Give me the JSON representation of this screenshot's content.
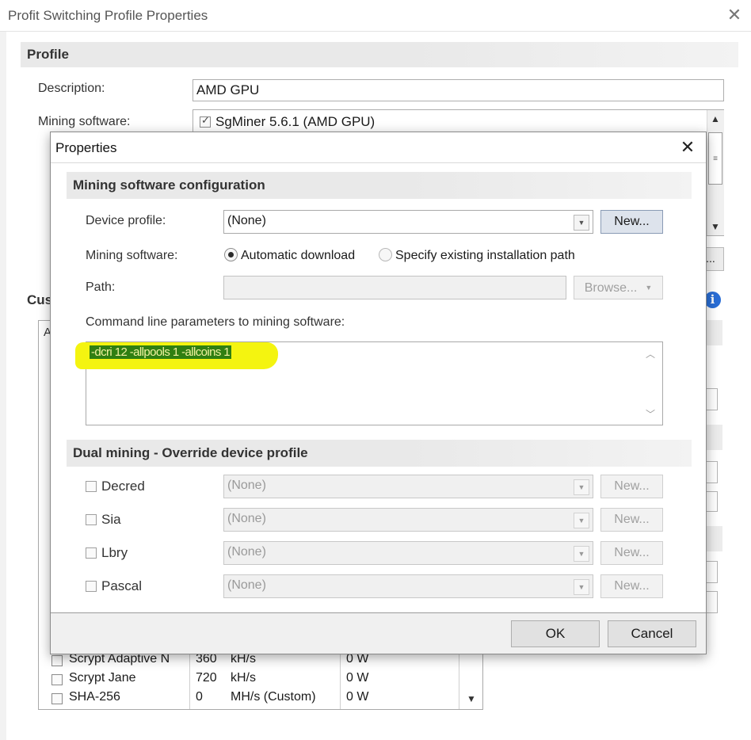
{
  "back_window": {
    "title": "Profit Switching Profile Properties",
    "close_glyph": "✕",
    "profile_section": "Profile",
    "description_label": "Description:",
    "description_value": "AMD GPU",
    "mining_software_label": "Mining software:",
    "mining_software_item": "SgMiner 5.6.1 (AMD GPU)",
    "dots_button": "...",
    "custom_section_partial": "Cus",
    "table_header_partial": "A",
    "algorithms": [
      {
        "name": "Scrypt Adaptive N",
        "value": "360",
        "unit": "kH/s",
        "power": "0 W"
      },
      {
        "name": "Scrypt Jane",
        "value": "720",
        "unit": "kH/s",
        "power": "0 W"
      },
      {
        "name": "SHA-256",
        "value": "0",
        "unit": "MH/s (Custom)",
        "power": "0 W"
      }
    ]
  },
  "dialog": {
    "title": "Properties",
    "close_glyph": "✕",
    "config_section": "Mining software configuration",
    "device_profile_label": "Device profile:",
    "device_profile_value": "(None)",
    "new_button": "New...",
    "mining_software_label": "Mining software:",
    "radio_auto": "Automatic download",
    "radio_path": "Specify existing installation path",
    "path_label": "Path:",
    "path_value": "",
    "browse_button": "Browse...",
    "cmd_label": "Command line parameters to mining software:",
    "cmd_value": "-dcri 12 -allpools 1 -allcoins 1",
    "dual_section": "Dual mining - Override device profile",
    "dual_rows": [
      {
        "label": "Decred",
        "value": "(None)",
        "button": "New..."
      },
      {
        "label": "Sia",
        "value": "(None)",
        "button": "New..."
      },
      {
        "label": "Lbry",
        "value": "(None)",
        "button": "New..."
      },
      {
        "label": "Pascal",
        "value": "(None)",
        "button": "New..."
      }
    ],
    "ok_button": "OK",
    "cancel_button": "Cancel"
  },
  "colors": {
    "highlight_marker": "#f4f410",
    "selection_bg": "#2f7f12",
    "info_icon": "#2a6ed6"
  },
  "icons": [
    "close-icon",
    "checkbox-icon",
    "chevron-down-icon",
    "chevron-up-icon",
    "info-icon",
    "radio-icon"
  ]
}
